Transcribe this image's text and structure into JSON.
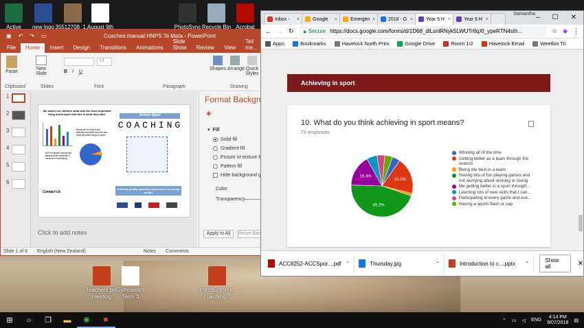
{
  "desktop": {
    "icons_top": [
      {
        "label": "Active",
        "color": "#1d6f42"
      },
      {
        "label": "new logo",
        "color": "#2a4d8f"
      },
      {
        "label": "35512708_1...",
        "color": "#8a6a4a"
      },
      {
        "label": "August 9th",
        "color": "#ffffff"
      }
    ],
    "icons_right": [
      {
        "label": "PhotoSync",
        "color": "#333333"
      },
      {
        "label": "Recycle Bin",
        "color": "#9ab"
      },
      {
        "label": "Acrobat",
        "color": "#b30b00"
      }
    ],
    "icons_bottom": [
      {
        "label": "Teachers pre meeting",
        "color": "#c43e1c"
      },
      {
        "label": "Gymnastics Term 3",
        "color": "#ffffff"
      },
      {
        "label": "Introduction to coaching...",
        "color": "#c43e1c"
      },
      {
        "label": "ACC8252-A...",
        "color": "#888888"
      },
      {
        "label": "Thursday",
        "color": "#6a8fb0"
      }
    ]
  },
  "powerpoint": {
    "title": "Coaches manual HNPS Te Mata - PowerPoint",
    "tabs": [
      "File",
      "Home",
      "Insert",
      "Design",
      "Transitions",
      "Animations",
      "Slide Show",
      "Review",
      "View",
      "Tell me..."
    ],
    "ribbon": {
      "paste": "Paste",
      "new_slide": "New Slide",
      "font_size": "14",
      "shapes": "Shapes",
      "arrange": "Arrange",
      "quick_styles": "Quick Styles",
      "groups": [
        "Clipboard",
        "Slides",
        "Font",
        "Paragraph",
        "Drawing"
      ]
    },
    "slide_numbers": [
      "1",
      "2",
      "3",
      "4",
      "5",
      "6"
    ],
    "slide": {
      "intro": "We asked our children what was the most important thing about sport and this is what they said.",
      "banner": "School Sport",
      "headline": "COACHING",
      "stat1": "Being part of a team and learning new skills were the two most important things to them.",
      "stat2": "84.9% enjoyed having their parents there watching or involved in fundraising.",
      "contact": "Contact Us",
      "tagline": "Creating quality sporting experiences for young people"
    },
    "notes_placeholder": "Click to add notes",
    "format_pane": {
      "title": "Format Background",
      "section": "Fill",
      "options": [
        "Solid fill",
        "Gradient fill",
        "Picture or texture fill",
        "Pattern fill"
      ],
      "hide_bg": "Hide background graphics",
      "color_label": "Color",
      "transparency_label": "Transparency",
      "apply_all": "Apply to All",
      "reset": "Reset Background"
    },
    "status": {
      "slide_of": "Slide 1 of 6",
      "language": "English (New Zealand)",
      "notes": "Notes",
      "comments": "Comments"
    }
  },
  "chrome": {
    "tabs": [
      {
        "label": "Inbox -",
        "color": "#d93025"
      },
      {
        "label": "Google",
        "color": "#f9ab00"
      },
      {
        "label": "Emergen",
        "color": "#f9ab00"
      },
      {
        "label": "2018 - G",
        "color": "#1a73e8"
      },
      {
        "label": "Year 5 H",
        "color": "#673ab7",
        "active": true
      },
      {
        "label": "Year 6 H",
        "color": "#673ab7"
      }
    ],
    "user": "Samantha",
    "url_secure": "Secure",
    "url": "https://docs.google.com/forms/d/1D68_dlLsnlRNyk5LWUTr8qXl_ypeRTN4sIh...",
    "bookmarks": [
      {
        "label": "Apps",
        "color": "#555555"
      },
      {
        "label": "Bookmarks",
        "color": "#1a73e8"
      },
      {
        "label": "Havelock North Prim",
        "color": "#777777"
      },
      {
        "label": "Google Drive",
        "color": "#0f9d58"
      },
      {
        "label": "Room 1/2",
        "color": "#d93025"
      },
      {
        "label": "Havelock Email",
        "color": "#d93025"
      },
      {
        "label": "Weetbix Tri",
        "color": "#777777"
      }
    ],
    "section_title": "Achieving in sport",
    "question": "10. What do you think achieving in sport means?",
    "responses": "73 responses",
    "downloads": [
      {
        "label": "ACC8252-ACCSpor....pdf",
        "color": "#b30b00"
      },
      {
        "label": "Thursday.jpg",
        "color": "#1a73e8"
      },
      {
        "label": "Introduction to c....pptx",
        "color": "#c43e1c"
      }
    ],
    "show_all": "Show all"
  },
  "chart_data": {
    "type": "pie",
    "title": "10. What do you think achieving in sport means?",
    "categories": [
      "Winning all of the time",
      "Getting better as a team through the season",
      "Being the best in a team",
      "Having lots of fun playing games and not worrying about winning or losing",
      "Me getting better in a sport through...",
      "Learning lots of new skills that I can...",
      "Participating in every game and eve...",
      "Having a sports flash or cap"
    ],
    "values": [
      4.1,
      19.2,
      1.4,
      45.2,
      16.4,
      5.5,
      4.1,
      4.1
    ],
    "colors": [
      "#3366cc",
      "#dc3912",
      "#ff9900",
      "#109618",
      "#990099",
      "#0099c6",
      "#dd4477",
      "#66aa00"
    ],
    "data_labels": [
      "",
      "19.2%",
      "",
      "45.2%",
      "16.4%",
      "",
      "",
      ""
    ]
  },
  "taskbar": {
    "language": "ENG",
    "time": "4:14 PM",
    "date": "9/07/2018"
  }
}
